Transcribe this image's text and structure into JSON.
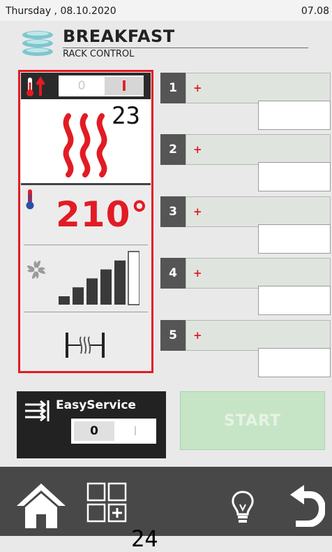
{
  "status": {
    "date": "Thursday , 08.10.2020",
    "time": "07.08"
  },
  "header": {
    "title": "BREAKFAST",
    "subtitle": "RACK CONTROL"
  },
  "panel": {
    "heat_switch": {
      "off_label": "0",
      "on_label": "I",
      "state": "on"
    },
    "heat_level": "23",
    "temperature": "210°",
    "fan_level": {
      "filled": 5,
      "total": 6
    }
  },
  "racks": [
    {
      "number": "1",
      "plus": "+"
    },
    {
      "number": "2",
      "plus": "+"
    },
    {
      "number": "3",
      "plus": "+"
    },
    {
      "number": "4",
      "plus": "+"
    },
    {
      "number": "5",
      "plus": "+"
    }
  ],
  "easy_service": {
    "label": "EasyService",
    "off_label": "0",
    "on_label": "I",
    "state": "off"
  },
  "start": {
    "label": "START",
    "enabled": false
  },
  "nav": {
    "count": "24"
  },
  "colors": {
    "accent_red": "#e21b24",
    "start_green": "#c6e5c6",
    "nav_bg": "#484848"
  },
  "icons": [
    "layers-logo-icon",
    "thermometer-up-icon",
    "heat-waves-icon",
    "thermometer-icon",
    "fan-icon",
    "fan-bars-icon",
    "damper-icon",
    "easy-service-icon",
    "home-icon",
    "grid-add-icon",
    "bulb-icon",
    "back-icon"
  ]
}
